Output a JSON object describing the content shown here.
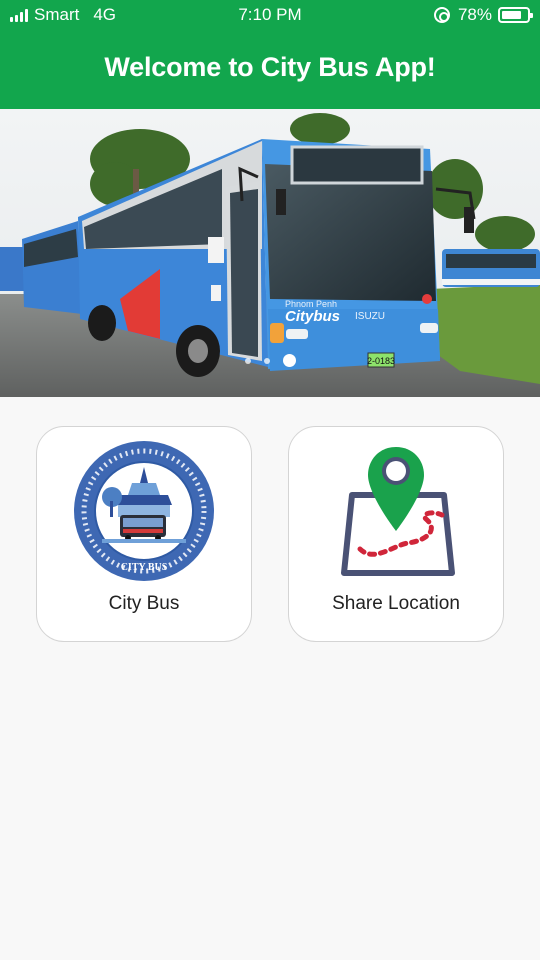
{
  "status_bar": {
    "carrier": "Smart",
    "network": "4G",
    "time": "7:10 PM",
    "battery_percent": "78%",
    "battery_level": 0.78,
    "icons": [
      "signal-icon",
      "orientation-lock-icon",
      "battery-icon"
    ]
  },
  "header": {
    "title": "Welcome to City Bus App!",
    "color": "#12a64d"
  },
  "banner": {
    "slide_count": 3,
    "active_slide": 3,
    "bus_text": {
      "brand_small": "Phnom Penh",
      "brand": "Citybus",
      "maker": "ISUZU",
      "plate": "2-0183"
    }
  },
  "tiles": [
    {
      "label": "City Bus",
      "icon": "city-bus-logo-icon",
      "logo_text": "CITY BUS"
    },
    {
      "label": "Share Location",
      "icon": "map-pin-route-icon"
    }
  ],
  "colors": {
    "accent": "#12a64d",
    "tile_border": "#d4d4d4",
    "pin": "#1aa24c",
    "route": "#d0263a",
    "map_frame": "#4a5275"
  }
}
